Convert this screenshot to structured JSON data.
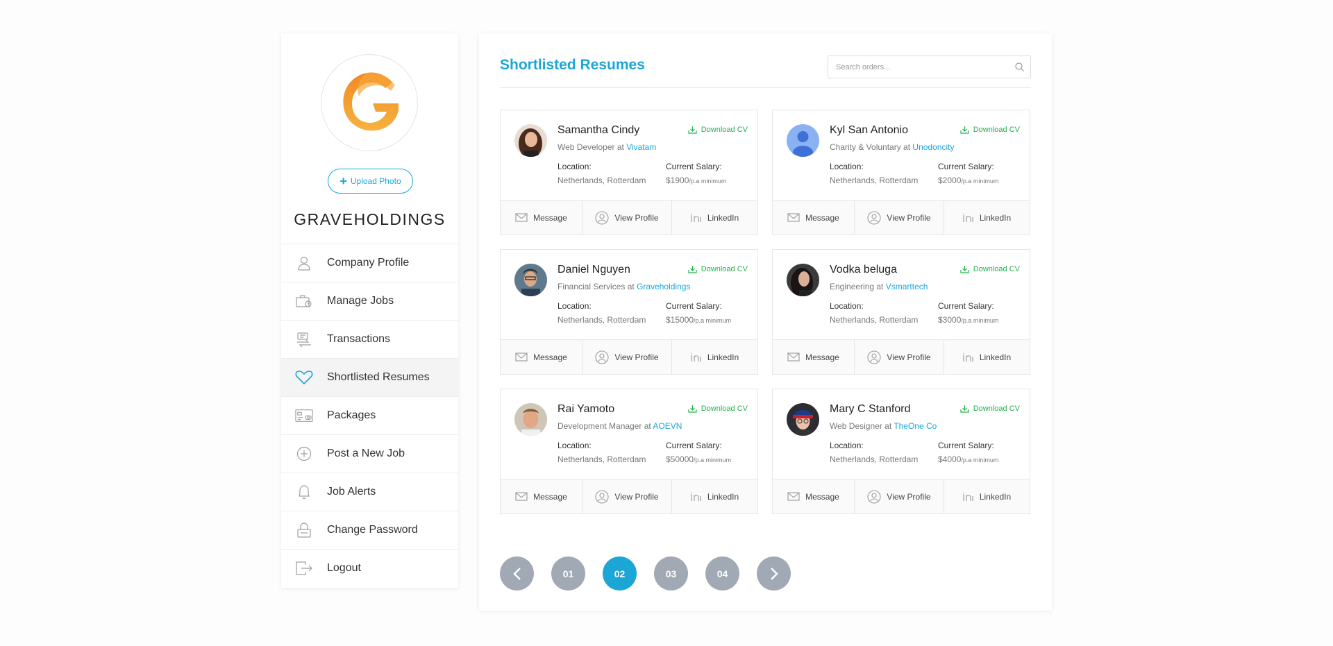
{
  "sidebar": {
    "logo_letter": "G",
    "upload_label": "Upload Photo",
    "company_name": "GRAVEHOLDINGS",
    "menu": [
      {
        "label": "Company Profile",
        "icon": "user-icon"
      },
      {
        "label": "Manage Jobs",
        "icon": "briefcase-icon"
      },
      {
        "label": "Transactions",
        "icon": "transactions-icon"
      },
      {
        "label": "Shortlisted Resumes",
        "icon": "heart-icon",
        "active": true
      },
      {
        "label": "Packages",
        "icon": "card-icon"
      },
      {
        "label": "Post a New Job",
        "icon": "plus-circle-icon"
      },
      {
        "label": "Job Alerts",
        "icon": "bell-icon"
      },
      {
        "label": "Change Password",
        "icon": "lock-icon"
      },
      {
        "label": "Logout",
        "icon": "logout-icon"
      }
    ]
  },
  "main": {
    "title": "Shortlisted Resumes",
    "search_placeholder": "Search orders...",
    "download_label": "Download CV",
    "location_label": "Location:",
    "salary_label": "Current Salary:",
    "salary_suffix": "/p.a minimum",
    "actions": {
      "message": "Message",
      "profile": "View Profile",
      "linkedin": "LinkedIn"
    },
    "resumes": [
      {
        "name": "Samantha Cindy",
        "role": "Web Developer at",
        "company": "Vivatam",
        "location": "Netherlands, Rotterdam",
        "salary": "$1900"
      },
      {
        "name": "Kyl San Antonio",
        "role": "Charity & Voluntary at",
        "company": "Unodoncity",
        "location": "Netherlands, Rotterdam",
        "salary": "$2000"
      },
      {
        "name": "Daniel Nguyen",
        "role": "Financial Services at",
        "company": "Graveholdings",
        "location": "Netherlands, Rotterdam",
        "salary": "$15000"
      },
      {
        "name": "Vodka beluga",
        "role": "Engineering at",
        "company": "Vsmarttech",
        "location": "Netherlands, Rotterdam",
        "salary": "$3000"
      },
      {
        "name": "Rai Yamoto",
        "role": "Development Manager at",
        "company": "AOEVN",
        "location": "Netherlands, Rotterdam",
        "salary": "$50000"
      },
      {
        "name": "Mary C Stanford",
        "role": "Web Designer at",
        "company": "TheOne Co",
        "location": "Netherlands, Rotterdam",
        "salary": "$4000"
      }
    ],
    "pagination": {
      "pages": [
        "01",
        "02",
        "03",
        "04"
      ],
      "current": "02",
      "prev_icon": "chevron-left-icon",
      "next_icon": "chevron-right-icon"
    }
  },
  "colors": {
    "accent": "#1ba6d6",
    "download": "#23b14d",
    "logo_orange": "#f0922b",
    "pager_gray": "#a0a9b4"
  }
}
